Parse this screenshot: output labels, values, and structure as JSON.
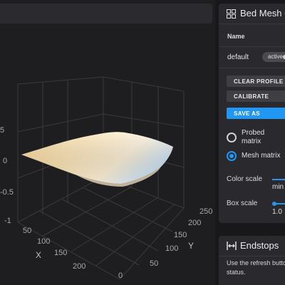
{
  "graph": {
    "z_ticks": [
      "5",
      "0",
      "-0.5",
      "-1"
    ],
    "x_ticks": [
      "50",
      "100",
      "150",
      "200"
    ],
    "y_ticks": [
      "0",
      "50",
      "100",
      "150",
      "200",
      "250"
    ],
    "x_label": "X",
    "y_label": "Y",
    "surface_colors": {
      "warm": "#ffdd9c",
      "cool": "#cfe4f5",
      "light": "#fff3d6"
    }
  },
  "bed_mesh": {
    "title": "Bed Mesh Co",
    "icon": "grid-icon",
    "table": {
      "name_header": "Name",
      "rows": [
        {
          "name": "default",
          "status": "active"
        }
      ]
    },
    "buttons": {
      "clear_profile": "CLEAR PROFILE",
      "calibrate": "CALIBRATE",
      "save_as": "SAVE AS"
    },
    "radios": {
      "probed_line1": "Probed",
      "probed_line2": "matrix",
      "mesh": "Mesh matrix",
      "selected": "mesh"
    },
    "color_scale": {
      "label": "Color scale",
      "value": "min"
    },
    "box_scale": {
      "label": "Box scale",
      "value": "1.0"
    },
    "accent": "#2196f3"
  },
  "endstops": {
    "title": "Endstops",
    "icon": "endstops-icon",
    "description_line1": "Use the refresh butto",
    "description_line2": "status."
  }
}
